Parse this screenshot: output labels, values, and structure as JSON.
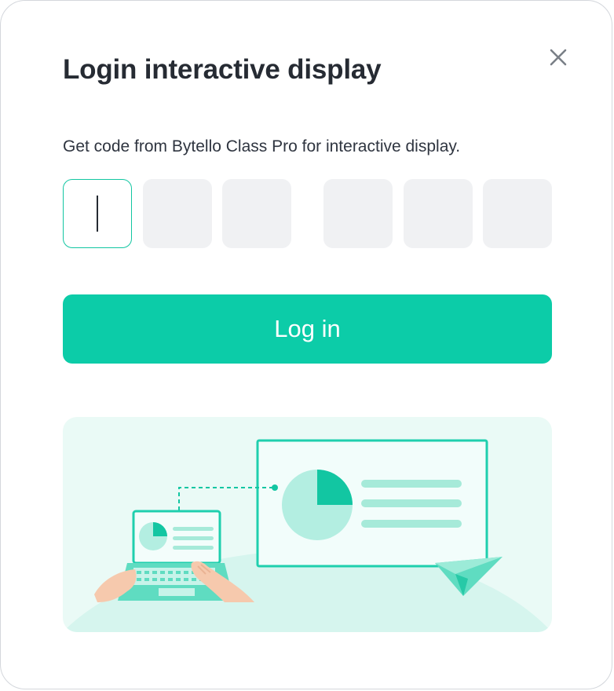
{
  "dialog": {
    "title": "Login interactive display",
    "subtitle": "Get code from Bytello Class Pro for interactive display.",
    "close_icon": "close-icon",
    "code": {
      "length": 6,
      "digits": [
        "",
        "",
        "",
        "",
        "",
        ""
      ],
      "active_index": 0
    },
    "login_button_label": "Log in",
    "illustration_icon": "laptop-to-display-illustration"
  },
  "colors": {
    "accent": "#0ccca8",
    "accent_border": "#12c6a2",
    "title": "#262b33",
    "text": "#2f3540",
    "box_bg": "#f0f1f3",
    "illustration_bg": "#eafaf6"
  }
}
